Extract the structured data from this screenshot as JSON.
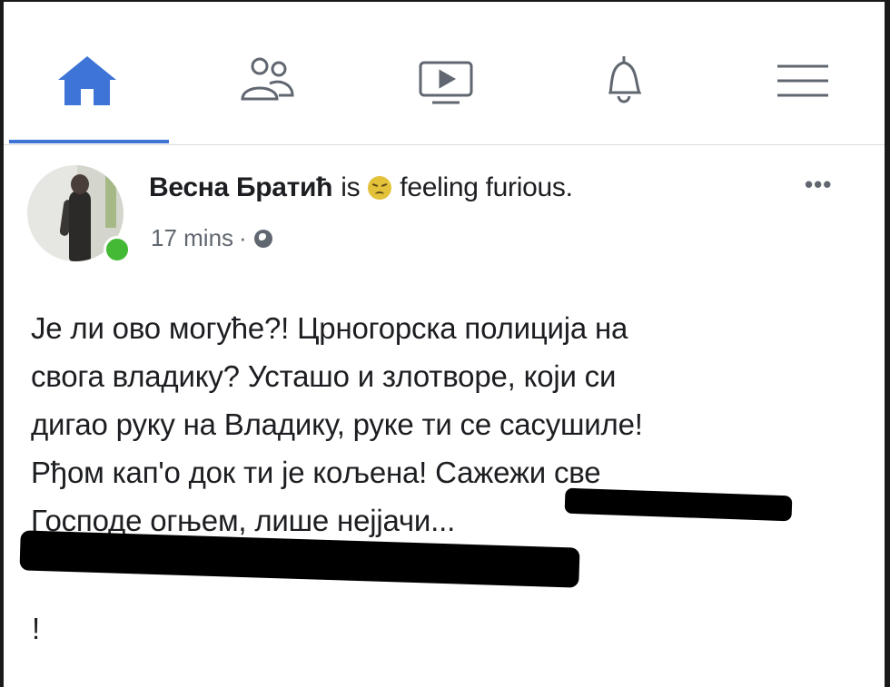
{
  "nav": {
    "items": [
      {
        "id": "home",
        "icon": "home-icon",
        "active": true
      },
      {
        "id": "friends",
        "icon": "friends-icon",
        "active": false
      },
      {
        "id": "watch",
        "icon": "video-play-icon",
        "active": false
      },
      {
        "id": "notifications",
        "icon": "bell-icon",
        "active": false
      },
      {
        "id": "menu",
        "icon": "hamburger-menu-icon",
        "active": false
      }
    ],
    "accent_color": "#3d74d6"
  },
  "post": {
    "author": "Весна Братић",
    "is_word": "is",
    "feeling_emoji": "furious-face-emoji",
    "feeling": "feeling furious.",
    "more_label": "•••",
    "time": "17 mins",
    "meta_separator": "·",
    "privacy_icon": "globe-icon",
    "online_color": "#43b935",
    "body_lines": [
      "Је ли ово могуће?! Црногорска полиција на",
      "свога владику? Усташо и злотворе, који си",
      "дигао руку на Владику, руке ти се сасушиле!",
      "Рђом кап'о док ти је кољена! Сажежи све",
      "Господе огњем, лише нејјачи..."
    ],
    "trailing": "!"
  }
}
